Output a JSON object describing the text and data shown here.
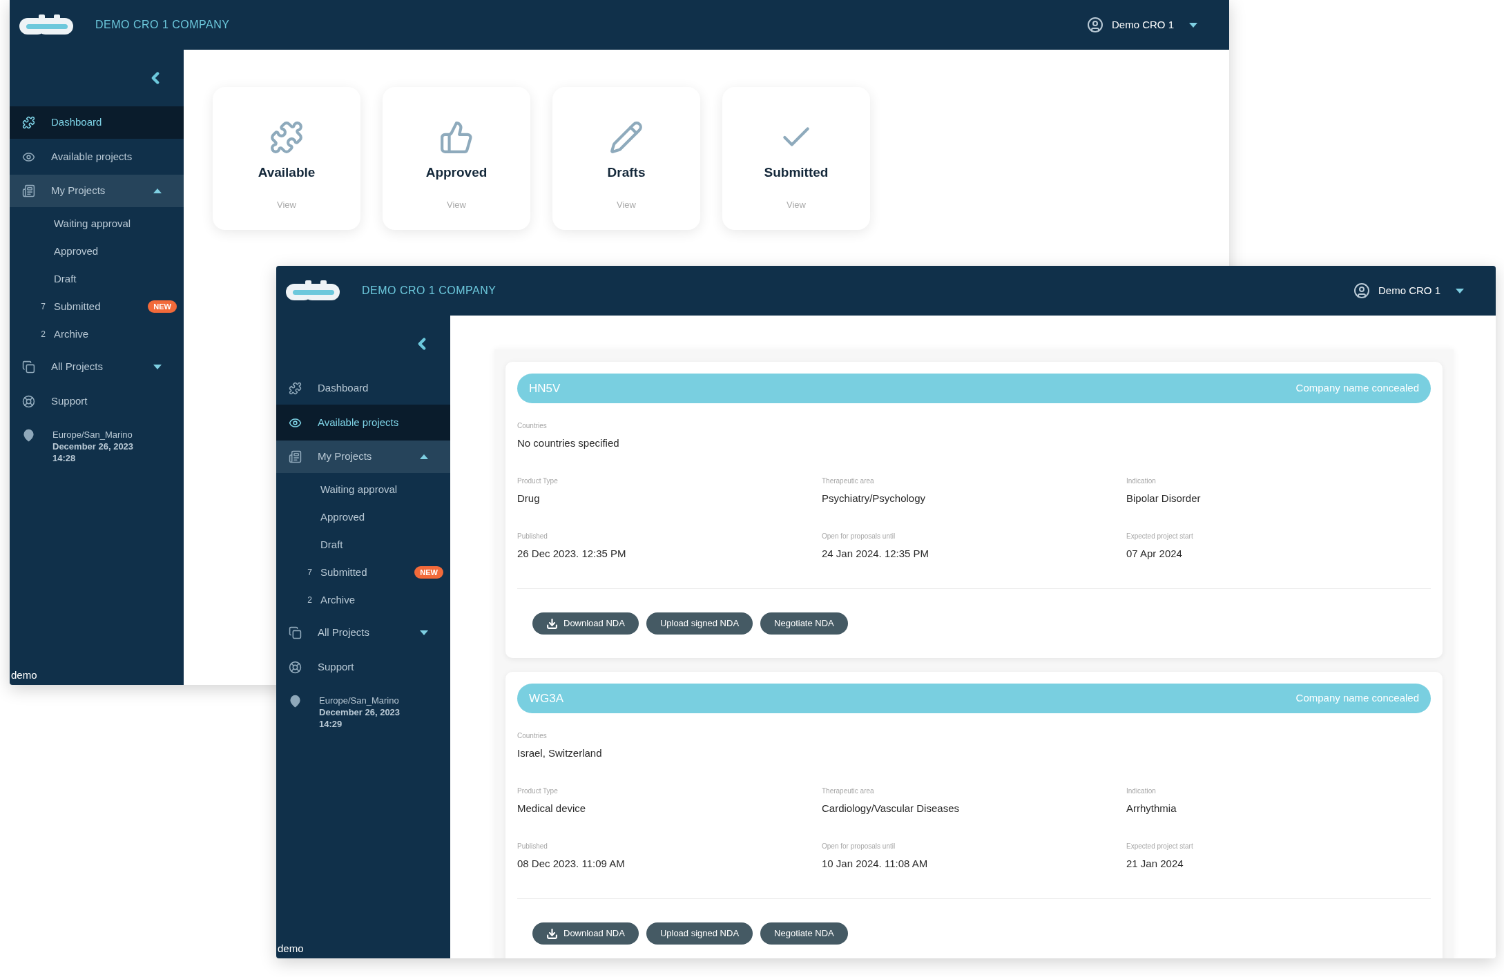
{
  "windows": [
    {
      "company": "DEMO CRO 1 COMPANY",
      "user": "Demo CRO 1",
      "sidebar": {
        "items": [
          {
            "label": "Dashboard",
            "kind": "link",
            "selected": true
          },
          {
            "label": "Available projects",
            "kind": "link",
            "selected": false
          },
          {
            "label": "My Projects",
            "kind": "group",
            "selected": false,
            "expanded": true,
            "children": [
              {
                "label": "Waiting approval",
                "selected": false
              },
              {
                "label": "Approved",
                "selected": false
              },
              {
                "label": "Draft",
                "selected": false
              },
              {
                "label": "Submitted",
                "count": "7",
                "badge": "NEW",
                "selected": false
              },
              {
                "label": "Archive",
                "count": "2",
                "selected": false
              }
            ]
          },
          {
            "label": "All Projects",
            "kind": "group",
            "selected": false,
            "expanded": false
          },
          {
            "label": "Support",
            "kind": "link",
            "selected": false
          }
        ],
        "location": {
          "timezone": "Europe/San_Marino",
          "date": "December 26, 2023",
          "time": "14:28"
        }
      },
      "footer": "demo",
      "content": {
        "kind": "dashboard",
        "tiles": [
          {
            "title": "Available",
            "link": "View"
          },
          {
            "title": "Approved",
            "link": "View"
          },
          {
            "title": "Drafts",
            "link": "View"
          },
          {
            "title": "Submitted",
            "link": "View"
          }
        ]
      }
    },
    {
      "company": "DEMO CRO 1 COMPANY",
      "user": "Demo CRO 1",
      "sidebar": {
        "items": [
          {
            "label": "Dashboard",
            "kind": "link",
            "selected": false
          },
          {
            "label": "Available projects",
            "kind": "link",
            "selected": true
          },
          {
            "label": "My Projects",
            "kind": "group",
            "selected": false,
            "expanded": true,
            "children": [
              {
                "label": "Waiting approval",
                "selected": false
              },
              {
                "label": "Approved",
                "selected": false
              },
              {
                "label": "Draft",
                "selected": false
              },
              {
                "label": "Submitted",
                "count": "7",
                "badge": "NEW",
                "selected": false
              },
              {
                "label": "Archive",
                "count": "2",
                "selected": false
              }
            ]
          },
          {
            "label": "All Projects",
            "kind": "group",
            "selected": false,
            "expanded": false
          },
          {
            "label": "Support",
            "kind": "link",
            "selected": false
          }
        ],
        "location": {
          "timezone": "Europe/San_Marino",
          "date": "December 26, 2023",
          "time": "14:29"
        }
      },
      "footer": "demo",
      "content": {
        "kind": "projects",
        "projects": [
          {
            "code": "HN5V",
            "company": "Company name concealed",
            "countries": {
              "label": "Countries",
              "value": "No countries specified"
            },
            "details": [
              {
                "label": "Product Type",
                "value": "Drug"
              },
              {
                "label": "Therapeutic area",
                "value": "Psychiatry/Psychology"
              },
              {
                "label": "Indication",
                "value": "Bipolar Disorder"
              },
              {
                "label": "Published",
                "value": "26 Dec 2023. 12:35 PM"
              },
              {
                "label": "Open for proposals until",
                "value": "24 Jan 2024. 12:35 PM"
              },
              {
                "label": "Expected project start",
                "value": "07 Apr 2024"
              }
            ],
            "buttons": [
              {
                "label": "Download NDA",
                "kind": "download"
              },
              {
                "label": "Upload signed NDA",
                "kind": "plain"
              },
              {
                "label": "Negotiate NDA",
                "kind": "plain"
              }
            ]
          },
          {
            "code": "WG3A",
            "company": "Company name concealed",
            "countries": {
              "label": "Countries",
              "value": "Israel, Switzerland"
            },
            "details": [
              {
                "label": "Product Type",
                "value": "Medical device"
              },
              {
                "label": "Therapeutic area",
                "value": "Cardiology/Vascular Diseases"
              },
              {
                "label": "Indication",
                "value": "Arrhythmia"
              },
              {
                "label": "Published",
                "value": "08 Dec 2023. 11:09 AM"
              },
              {
                "label": "Open for proposals until",
                "value": "10 Jan 2024. 11:08 AM"
              },
              {
                "label": "Expected project start",
                "value": "21 Jan 2024"
              }
            ],
            "buttons": [
              {
                "label": "Download NDA",
                "kind": "download"
              },
              {
                "label": "Upload signed NDA",
                "kind": "plain"
              },
              {
                "label": "Negotiate NDA",
                "kind": "plain"
              }
            ]
          }
        ]
      }
    }
  ]
}
